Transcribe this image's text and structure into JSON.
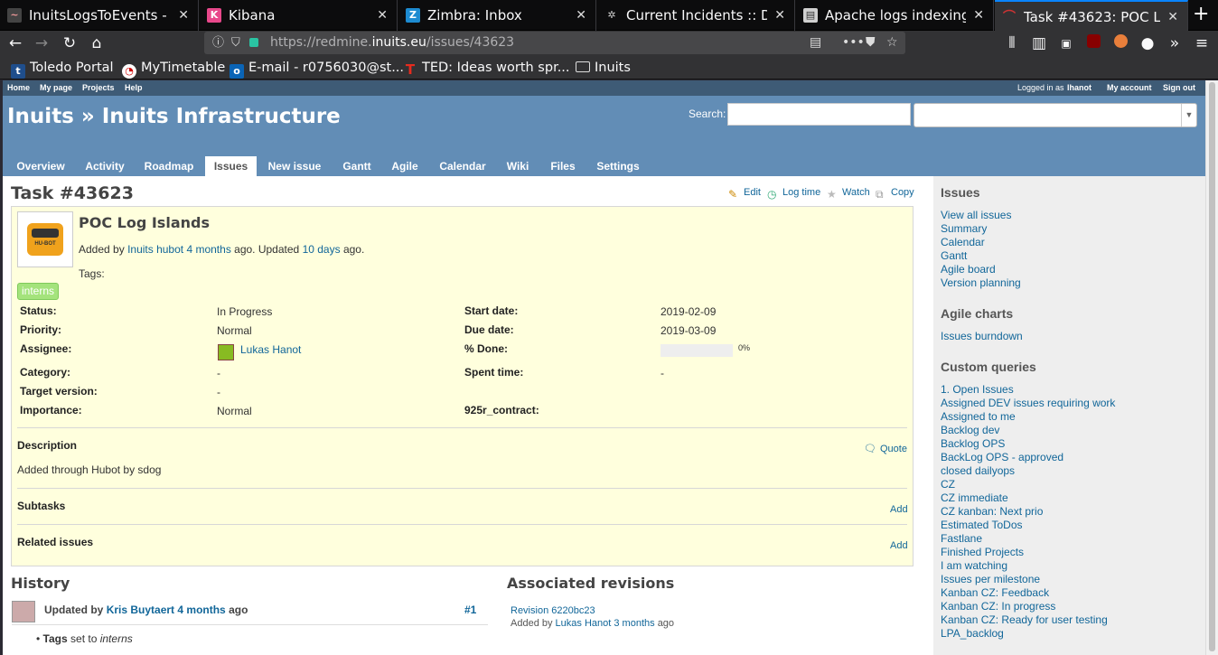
{
  "browser": {
    "tabs": [
      {
        "label": "InuitsLogsToEvents - St",
        "icon": "terminal-icon"
      },
      {
        "label": "Kibana",
        "icon": "kibana-icon"
      },
      {
        "label": "Zimbra: Inbox",
        "icon": "zimbra-icon"
      },
      {
        "label": "Current Incidents :: Das",
        "icon": "incidents-icon"
      },
      {
        "label": "Apache logs indexing w",
        "icon": "apache-icon"
      },
      {
        "label": "Task #43623: POC Log I",
        "icon": "redmine-icon"
      }
    ],
    "url_prefix": "https://redmine.",
    "url_domain": "inuits.eu",
    "url_path": "/issues/43623",
    "bookmarks": [
      "Toledo Portal",
      "MyTimetable",
      "E-mail - r0756030@st...",
      "TED: Ideas worth spr...",
      "Inuits"
    ]
  },
  "topmenu": {
    "left": [
      "Home",
      "My page",
      "Projects",
      "Help"
    ],
    "logged_prefix": "Logged in as",
    "user": "lhanot",
    "my_account": "My account",
    "sign_out": "Sign out"
  },
  "header": {
    "title": "Inuits » Inuits Infrastructure",
    "search_label": "Search:",
    "jump_placeholder": "Jump to a project..."
  },
  "main_tabs": [
    "Overview",
    "Activity",
    "Roadmap",
    "Issues",
    "New issue",
    "Gantt",
    "Agile",
    "Calendar",
    "Wiki",
    "Files",
    "Settings"
  ],
  "issue": {
    "heading": "Task #43623",
    "actions": [
      "Edit",
      "Log time",
      "Watch",
      "Copy"
    ],
    "subject": "POC Log Islands",
    "added_by_prefix": "Added by",
    "author": "Inuits hubot",
    "created": "4 months",
    "ago1": "ago. Updated",
    "updated": "10 days",
    "ago2": "ago.",
    "tags_label": "Tags:",
    "tag": "interns",
    "avatar_text": "HU-BOT",
    "fields_left": [
      {
        "label": "Status:",
        "value": "In Progress"
      },
      {
        "label": "Priority:",
        "value": "Normal"
      },
      {
        "label": "Assignee:",
        "value": "Lukas Hanot"
      },
      {
        "label": "Category:",
        "value": "-"
      },
      {
        "label": "Target version:",
        "value": "-"
      },
      {
        "label": "Importance:",
        "value": "Normal"
      }
    ],
    "fields_right": [
      {
        "label": "Start date:",
        "value": "2019-02-09"
      },
      {
        "label": "Due date:",
        "value": "2019-03-09"
      },
      {
        "label": "% Done:",
        "value": "0%"
      },
      {
        "label": "Spent time:",
        "value": "-"
      },
      {
        "label": "925r_contract:",
        "value": ""
      }
    ],
    "done_fraction": 0,
    "description_label": "Description",
    "quote": "Quote",
    "description": "Added through Hubot by sdog",
    "subtasks_label": "Subtasks",
    "related_label": "Related issues",
    "add": "Add"
  },
  "history": {
    "heading": "History",
    "updated_by": "Updated by",
    "author": "Kris Buytaert",
    "when": "4 months",
    "ago": "ago",
    "number": "#1",
    "detail_label": "Tags",
    "detail_middle": "set to",
    "detail_value": "interns"
  },
  "revisions": {
    "heading": "Associated revisions",
    "revision": "Revision 6220bc23",
    "added_by": "Added by",
    "author": "Lukas Hanot",
    "when": "3 months",
    "ago": "ago"
  },
  "sidebar": {
    "issues_heading": "Issues",
    "issues_links": [
      "View all issues",
      "Summary",
      "Calendar",
      "Gantt",
      "Agile board",
      "Version planning"
    ],
    "agile_heading": "Agile charts",
    "agile_links": [
      "Issues burndown"
    ],
    "queries_heading": "Custom queries",
    "queries": [
      "1. Open Issues",
      "Assigned DEV issues requiring work",
      "Assigned to me",
      "Backlog dev",
      "Backlog OPS",
      "BackLog OPS - approved",
      "closed dailyops",
      "CZ",
      "CZ immediate",
      "CZ kanban: Next prio",
      "Estimated ToDos",
      "Fastlane",
      "Finished Projects",
      "I am watching",
      "Issues per milestone",
      "Kanban CZ: Feedback",
      "Kanban CZ: In progress",
      "Kanban CZ: Ready for user testing",
      "LPA_backlog"
    ]
  }
}
